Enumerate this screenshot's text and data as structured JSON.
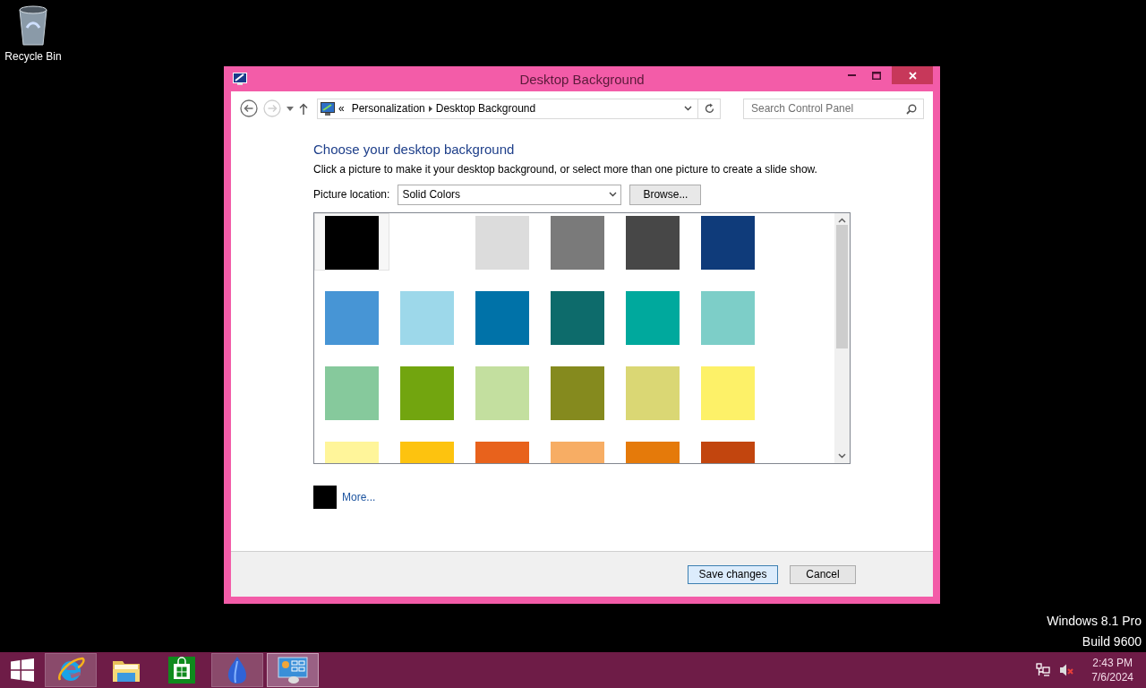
{
  "desktop_icons": [
    {
      "label": "Recycle Bin"
    }
  ],
  "window": {
    "title": "Desktop Background"
  },
  "address_bar": {
    "overflow": "«",
    "breadcrumbs": [
      "Personalization",
      "Desktop Background"
    ]
  },
  "search": {
    "placeholder": "Search Control Panel"
  },
  "heading": "Choose your desktop background",
  "instructions": "Click a picture to make it your desktop background, or select more than one picture to create a slide show.",
  "picture_location": {
    "label": "Picture location:",
    "value": "Solid Colors"
  },
  "browse_button": "Browse...",
  "swatches": [
    {
      "color": "#000000",
      "selected": true
    },
    {
      "color": "#ffffff",
      "selected": false
    },
    {
      "color": "#dcdcdc",
      "selected": false
    },
    {
      "color": "#7a7a7a",
      "selected": false
    },
    {
      "color": "#474747",
      "selected": false
    },
    {
      "color": "#0f3b7a",
      "selected": false
    },
    {
      "color": "#4795d5",
      "selected": false
    },
    {
      "color": "#9dd8ea",
      "selected": false
    },
    {
      "color": "#0072a8",
      "selected": false
    },
    {
      "color": "#0d6b6b",
      "selected": false
    },
    {
      "color": "#00a99d",
      "selected": false
    },
    {
      "color": "#7dcec8",
      "selected": false
    },
    {
      "color": "#86c99c",
      "selected": false
    },
    {
      "color": "#72a50f",
      "selected": false
    },
    {
      "color": "#c3df9f",
      "selected": false
    },
    {
      "color": "#858a1e",
      "selected": false
    },
    {
      "color": "#dad774",
      "selected": false
    },
    {
      "color": "#fdf168",
      "selected": false
    },
    {
      "color": "#fff59a",
      "selected": false
    },
    {
      "color": "#fdc30f",
      "selected": false
    },
    {
      "color": "#e8621c",
      "selected": false
    },
    {
      "color": "#f7ad64",
      "selected": false
    },
    {
      "color": "#e57a0a",
      "selected": false
    },
    {
      "color": "#c2450e",
      "selected": false
    }
  ],
  "more": {
    "color": "#000000",
    "label": "More..."
  },
  "buttons": [
    {
      "label": "Save changes",
      "focused": true
    },
    {
      "label": "Cancel",
      "focused": false
    }
  ],
  "edition_text": [
    "Windows 8.1 Pro",
    "Build 9600"
  ],
  "taskbar": {
    "apps": [
      {
        "kind": "browser",
        "running": true,
        "selected": false
      },
      {
        "kind": "files",
        "running": false,
        "selected": false
      },
      {
        "kind": "store",
        "running": false,
        "selected": false
      },
      {
        "kind": "flame",
        "running": true,
        "selected": false
      },
      {
        "kind": "control-panel",
        "running": true,
        "selected": true
      }
    ],
    "clock": {
      "time": "2:43 PM",
      "date": "7/6/2024"
    }
  }
}
